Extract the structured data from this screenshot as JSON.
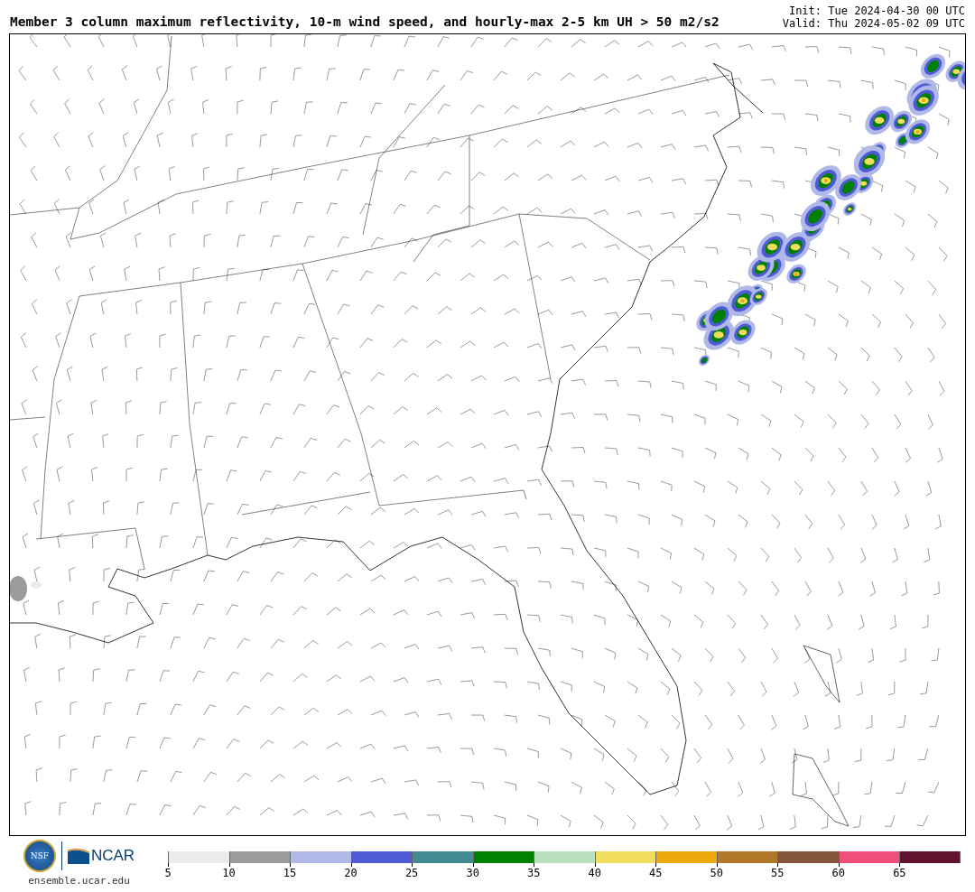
{
  "title": "Member 3 column maximum reflectivity, 10-m wind speed, and hourly-max 2-5 km UH > 50 m2/s2",
  "init": "Init: Tue 2024-04-30 00 UTC",
  "valid": "Valid: Thu 2024-05-02 09 UTC",
  "logo": {
    "seal": "NSF",
    "org": "NCAR",
    "url": "ensemble.ucar.edu"
  },
  "colorbar": {
    "bins": [
      {
        "label": "5",
        "color": "#ebebeb"
      },
      {
        "label": "10",
        "color": "#9b9b9b"
      },
      {
        "label": "15",
        "color": "#b0b8e8"
      },
      {
        "label": "20",
        "color": "#4f5ad6"
      },
      {
        "label": "25",
        "color": "#428b93"
      },
      {
        "label": "30",
        "color": "#008000"
      },
      {
        "label": "35",
        "color": "#b9dfbf"
      },
      {
        "label": "40",
        "color": "#f2dc5c"
      },
      {
        "label": "45",
        "color": "#eca80c"
      },
      {
        "label": "50",
        "color": "#b07828"
      },
      {
        "label": "55",
        "color": "#83553c"
      },
      {
        "label": "60",
        "color": "#ef4f78"
      },
      {
        "label": "65",
        "color": "#62122f"
      }
    ]
  }
}
